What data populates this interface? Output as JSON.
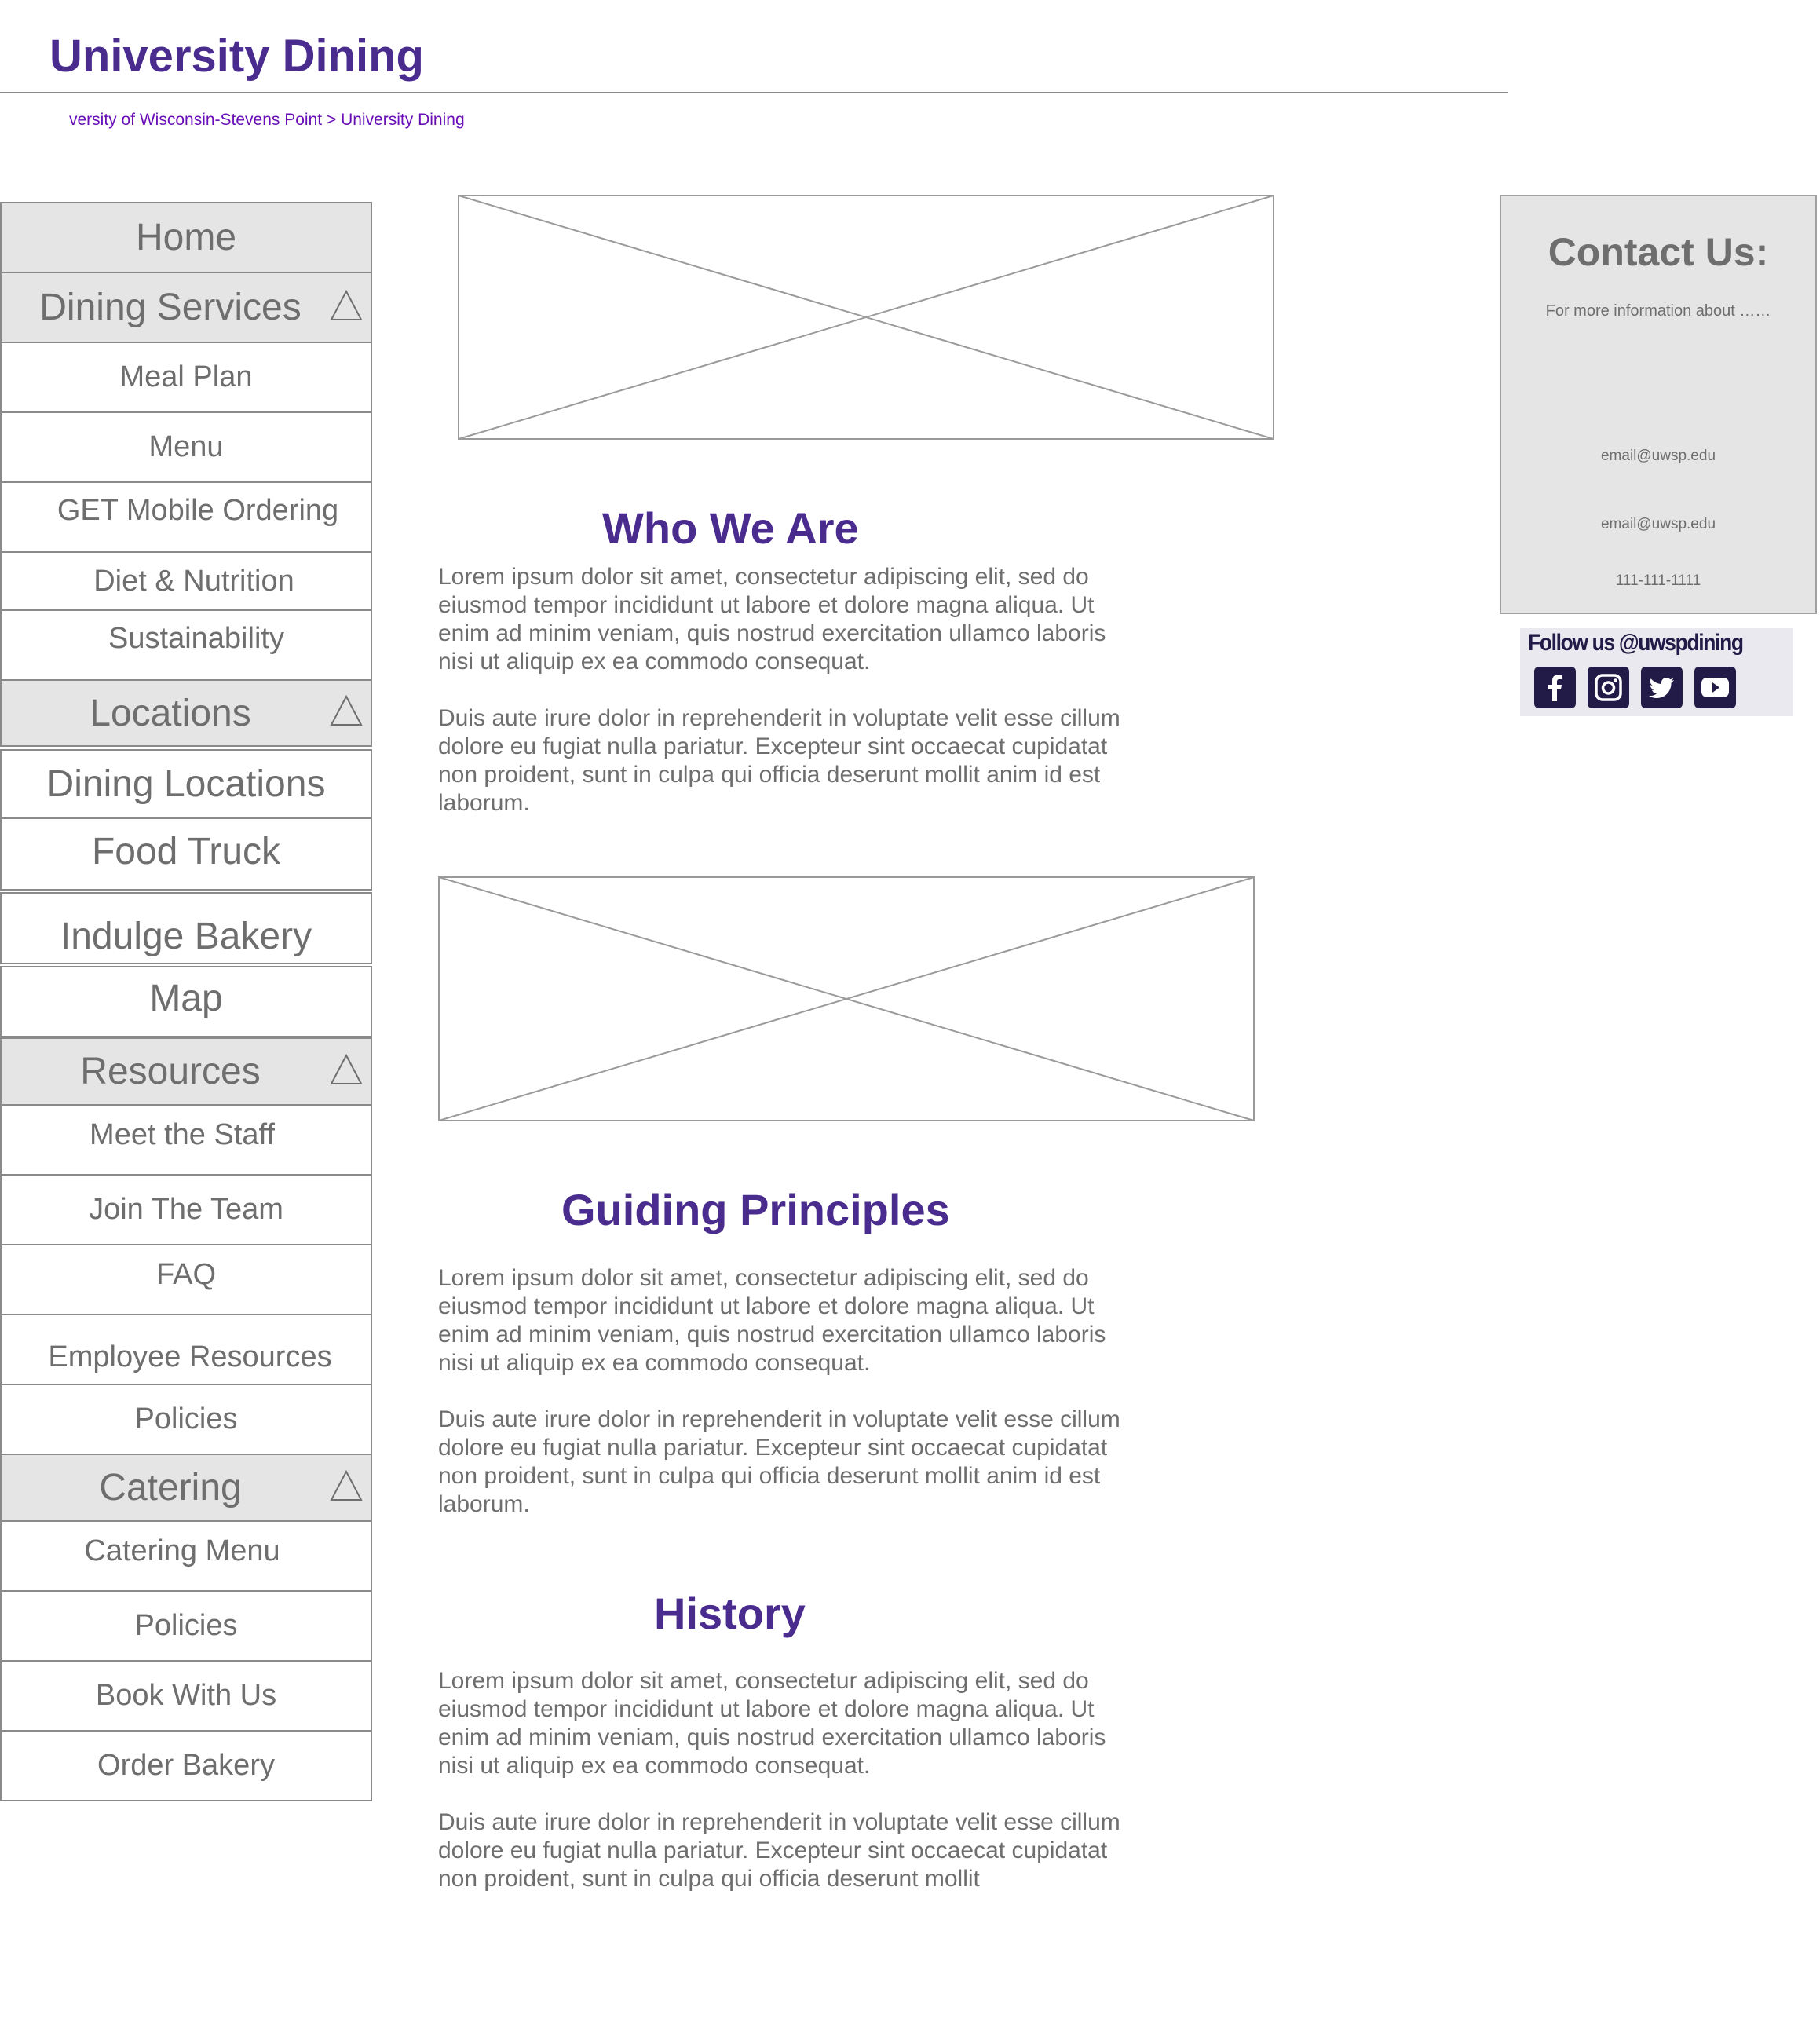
{
  "header": {
    "title": "University Dining",
    "breadcrumb": {
      "parent": "versity of Wisconsin-Stevens Point",
      "separator": ">",
      "current": "University Dining"
    }
  },
  "sidebar": {
    "items": [
      {
        "label": "Home",
        "type": "section"
      },
      {
        "label": "Dining Services",
        "type": "section",
        "expandable": true
      },
      {
        "label": "Meal Plan",
        "type": "sub"
      },
      {
        "label": "Menu",
        "type": "sub"
      },
      {
        "label": "GET Mobile Ordering",
        "type": "sub"
      },
      {
        "label": "Diet & Nutrition",
        "type": "sub"
      },
      {
        "label": "Sustainability",
        "type": "sub"
      },
      {
        "label": "Locations",
        "type": "section",
        "expandable": true
      },
      {
        "label": "Dining Locations",
        "type": "sub"
      },
      {
        "label": "Food Truck",
        "type": "sub"
      },
      {
        "label": "Indulge Bakery",
        "type": "sub"
      },
      {
        "label": "Map",
        "type": "sub"
      },
      {
        "label": "Resources",
        "type": "section",
        "expandable": true
      },
      {
        "label": "Meet the Staff",
        "type": "sub"
      },
      {
        "label": "Join The Team",
        "type": "sub"
      },
      {
        "label": "FAQ",
        "type": "sub"
      },
      {
        "label": "Employee Resources",
        "type": "sub"
      },
      {
        "label": "Policies",
        "type": "sub"
      },
      {
        "label": "Catering",
        "type": "section",
        "expandable": true
      },
      {
        "label": "Catering Menu",
        "type": "sub"
      },
      {
        "label": "Policies",
        "type": "sub"
      },
      {
        "label": "Book With Us",
        "type": "sub"
      },
      {
        "label": "Order Bakery",
        "type": "sub"
      }
    ]
  },
  "main": {
    "who_we_are": {
      "heading": "Who We Are",
      "paragraphs": [
        "Lorem ipsum dolor sit amet, consectetur adipiscing elit, sed do eiusmod tempor incididunt ut labore et dolore magna aliqua. Ut enim ad minim veniam, quis nostrud exercitation ullamco laboris nisi ut aliquip ex ea commodo consequat.",
        "Duis aute irure dolor in reprehenderit in voluptate velit esse cillum dolore eu fugiat nulla pariatur. Excepteur sint occaecat cupidatat non proident, sunt in culpa qui officia deserunt mollit anim id est laborum."
      ]
    },
    "guiding_principles": {
      "heading": "Guiding Principles",
      "paragraphs": [
        "Lorem ipsum dolor sit amet, consectetur adipiscing elit, sed do eiusmod tempor incididunt ut labore et dolore magna aliqua. Ut enim ad minim veniam, quis nostrud exercitation ullamco laboris nisi ut aliquip ex ea commodo consequat.",
        "Duis aute irure dolor in reprehenderit in voluptate velit esse cillum dolore eu fugiat nulla pariatur. Excepteur sint occaecat cupidatat non proident, sunt in culpa qui officia deserunt mollit anim id est laborum."
      ]
    },
    "history": {
      "heading": "History",
      "paragraphs": [
        "Lorem ipsum dolor sit amet, consectetur adipiscing elit, sed do eiusmod tempor incididunt ut labore et dolore magna aliqua. Ut enim ad minim veniam, quis nostrud exercitation ullamco laboris nisi ut aliquip ex ea commodo consequat.",
        "Duis aute irure dolor in reprehenderit in voluptate velit esse cillum dolore eu fugiat nulla pariatur. Excepteur sint occaecat cupidatat non proident, sunt in culpa qui officia deserunt mollit"
      ]
    }
  },
  "contact": {
    "title": "Contact Us:",
    "description": "For more information about ……",
    "email_1": "email@uwsp.edu",
    "email_2": "email@uwsp.edu",
    "phone": "111-111-1111"
  },
  "social": {
    "label": "Follow us @uwspdining",
    "icons": [
      "facebook-icon",
      "instagram-icon",
      "twitter-icon",
      "youtube-icon"
    ]
  },
  "colors": {
    "brand": "#4a2b8e",
    "breadcrumb": "#6a0fb8",
    "section_bg": "#e5e5e5",
    "social_icon": "#221a47"
  }
}
